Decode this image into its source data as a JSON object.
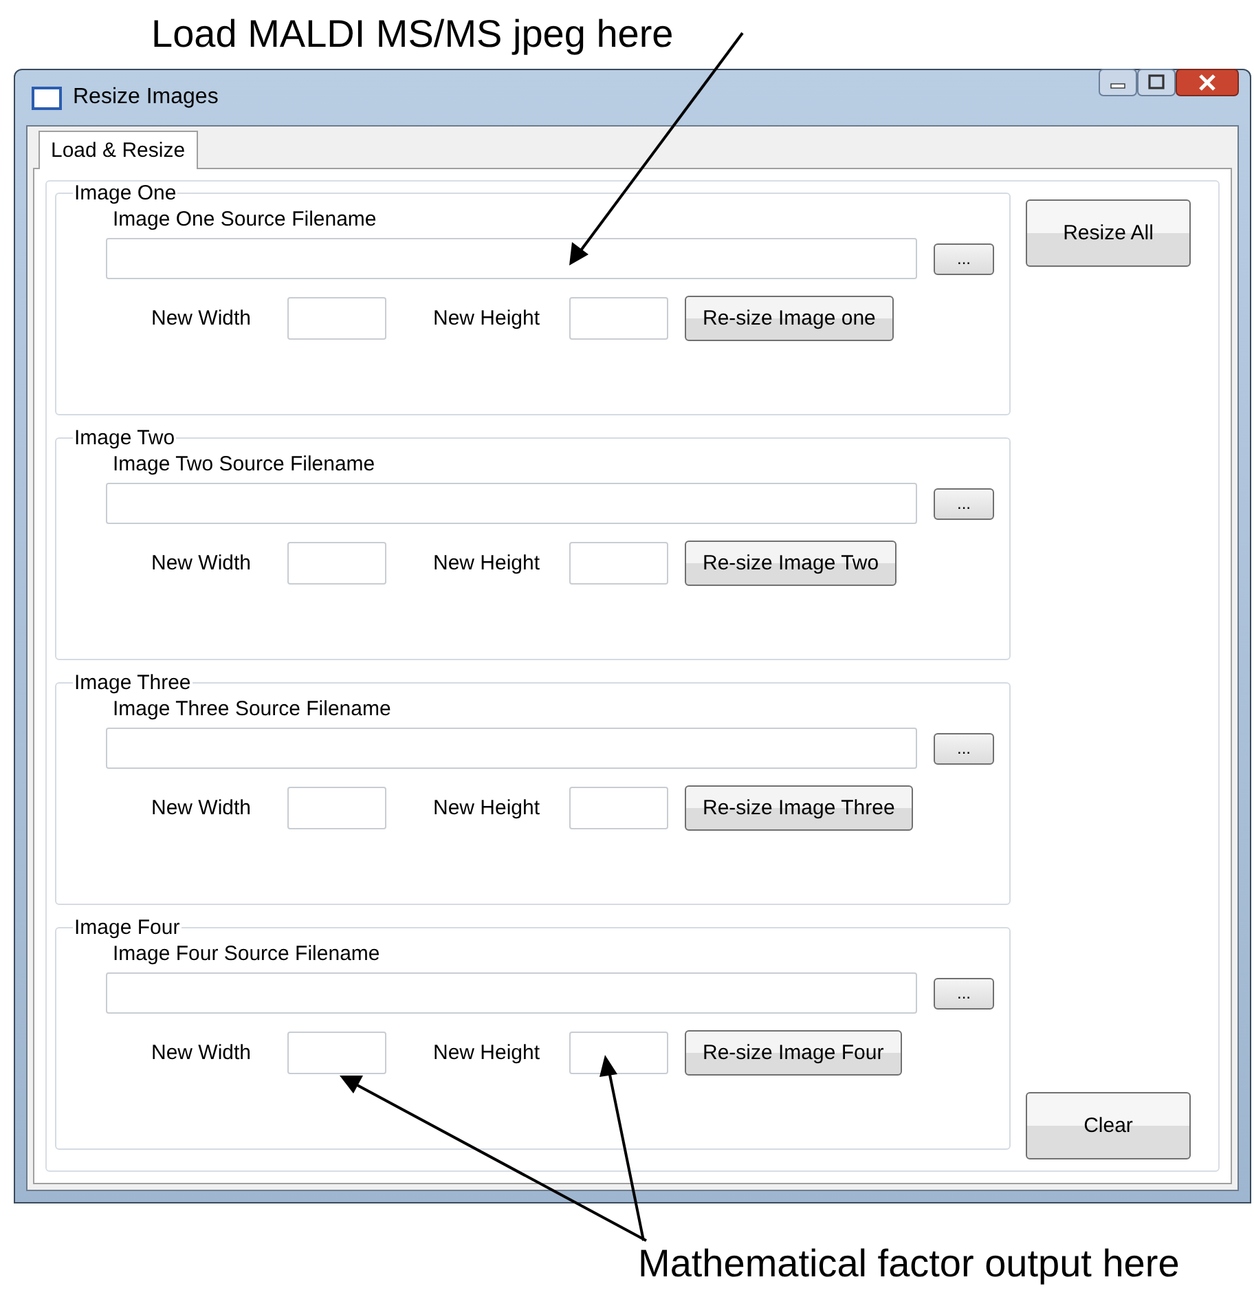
{
  "annotation_top": "Load MALDI MS/MS jpeg here",
  "window": {
    "title": "Resize Images"
  },
  "tabs": [
    {
      "label": "Load & Resize",
      "selected": true
    }
  ],
  "groups": [
    {
      "title": "Image One",
      "source_label": "Image One Source Filename",
      "browse": "...",
      "width_label": "New Width",
      "height_label": "New Height",
      "resize_button": "Re-size Image one"
    },
    {
      "title": "Image Two",
      "source_label": "Image Two Source Filename",
      "browse": "...",
      "width_label": "New Width",
      "height_label": "New Height",
      "resize_button": "Re-size Image Two"
    },
    {
      "title": "Image Three",
      "source_label": "Image Three Source Filename",
      "browse": "...",
      "width_label": "New Width",
      "height_label": "New Height",
      "resize_button": "Re-size Image Three"
    },
    {
      "title": "Image Four",
      "source_label": "Image Four Source Filename",
      "browse": "...",
      "width_label": "New Width",
      "height_label": "New Height",
      "resize_button": "Re-size Image Four"
    }
  ],
  "resize_all": "Resize All",
  "clear": "Clear",
  "annotation_bottom": "Mathematical factor output here"
}
